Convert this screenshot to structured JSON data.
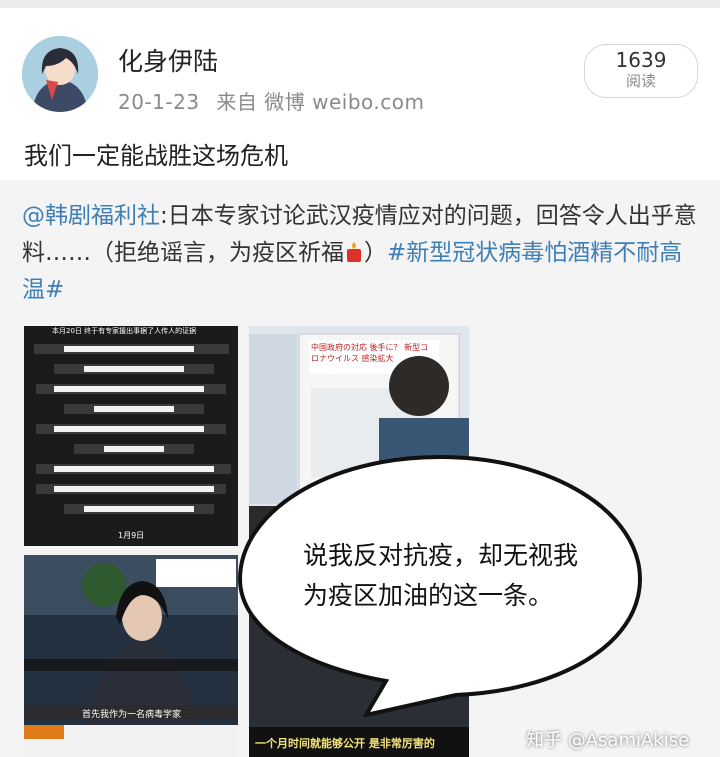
{
  "post": {
    "username": "化身伊陆",
    "date": "20-1-23",
    "source": "来自 微博 weibo.com",
    "read_count": "1639",
    "read_label": "阅读",
    "text": "我们一定能战胜这场危机"
  },
  "repost": {
    "mention": "@韩剧福利社",
    "body": ":日本专家讨论武汉疫情应对的问题，回答令人出乎意料……（拒绝谣言，为疫区祈福",
    "body_end": "）",
    "hashtag": "#新型冠状病毒怕酒精不耐高温#"
  },
  "images": {
    "image1_caption": "本月20日 终于有专家援出事据了人传人的证据",
    "image1_date": "1月9日",
    "image2_caption": "中国政府の対応 後手に？ 新型コロナウイルス 感染拡大",
    "image3_caption": "首先我作为一名病毒学家",
    "image4_caption": "一个月时间就能够公开 是非常厉害的"
  },
  "bubble": {
    "text": "说我反对抗疫，却无视我为疫区加油的这一条。"
  },
  "watermark": "知乎 @AsamiAkise"
}
